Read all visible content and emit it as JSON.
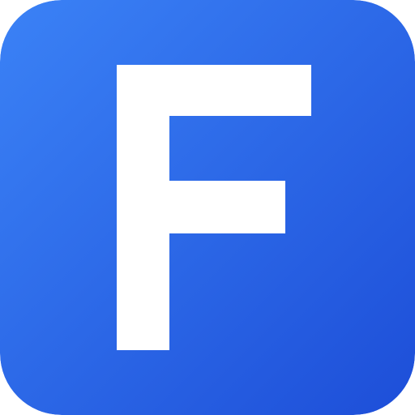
{
  "icon": {
    "letter": "F",
    "gradient_start": "#3B82F6",
    "gradient_end": "#1D4ED8",
    "glyph_color": "#FFFFFF"
  }
}
